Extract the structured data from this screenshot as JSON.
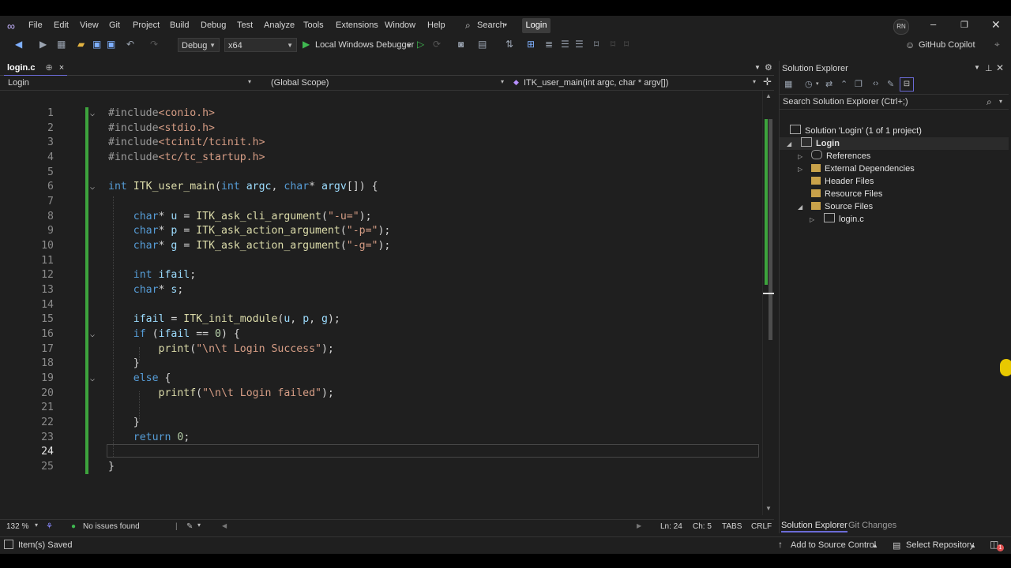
{
  "menu": {
    "items": [
      "File",
      "Edit",
      "View",
      "Git",
      "Project",
      "Build",
      "Debug",
      "Test",
      "Analyze",
      "Tools",
      "Extensions",
      "Window",
      "Help"
    ],
    "search_label": "Search",
    "solution_name": "Login",
    "avatar_initials": "RN"
  },
  "toolbar": {
    "config": "Debug",
    "platform": "x64",
    "run_label": "Local Windows Debugger",
    "copilot_label": "GitHub Copilot"
  },
  "editor": {
    "tab_label": "login.c",
    "tab_pin": "⊕",
    "tab_close": "×",
    "nav_project": "Login",
    "nav_scope": "(Global Scope)",
    "nav_function": "ITK_user_main(int argc, char * argv[])",
    "current_line": 24,
    "line_numbers": [
      "1",
      "2",
      "3",
      "4",
      "5",
      "6",
      "7",
      "8",
      "9",
      "10",
      "11",
      "12",
      "13",
      "14",
      "15",
      "16",
      "17",
      "18",
      "19",
      "20",
      "21",
      "22",
      "23",
      "24",
      "25"
    ],
    "lines": [
      "#include<conio.h>",
      "#include<stdio.h>",
      "#include<tcinit/tcinit.h>",
      "#include<tc/tc_startup.h>",
      "",
      "int ITK_user_main(int argc, char* argv[]) {",
      "",
      "    char* u = ITK_ask_cli_argument(\"-u=\");",
      "    char* p = ITK_ask_action_argument(\"-p=\");",
      "    char* g = ITK_ask_action_argument(\"-g=\");",
      "",
      "    int ifail;",
      "    char* s;",
      "",
      "    ifail = ITK_init_module(u, p, g);",
      "    if (ifail == 0) {",
      "        print(\"\\n\\t Login Success\");",
      "    }",
      "    else {",
      "        printf(\"\\n\\t Login failed\");",
      "",
      "    }",
      "    return 0;",
      "",
      "}"
    ]
  },
  "editor_status": {
    "zoom": "132 %",
    "issues": "No issues found",
    "line": "Ln: 24",
    "col": "Ch: 5",
    "tabs": "TABS",
    "eol": "CRLF"
  },
  "solution_explorer": {
    "title": "Solution Explorer",
    "search_placeholder": "Search Solution Explorer (Ctrl+;)",
    "solution_label": "Solution 'Login' (1 of 1 project)",
    "project_label": "Login",
    "nodes": [
      "References",
      "External Dependencies",
      "Header Files",
      "Resource Files",
      "Source Files"
    ],
    "file_label": "login.c",
    "tab_solution": "Solution Explorer",
    "tab_git": "Git Changes"
  },
  "statusbar": {
    "saved": "Item(s) Saved",
    "source_control": "Add to Source Control",
    "repository": "Select Repository",
    "notification_count": "1"
  },
  "colors": {
    "accent": "#6b6bd6",
    "change_bar": "#3da33d",
    "keyword": "#569cd6",
    "string": "#d69d85",
    "function": "#dcdcaa",
    "identifier": "#9cdcfe",
    "number": "#b5cea8"
  }
}
